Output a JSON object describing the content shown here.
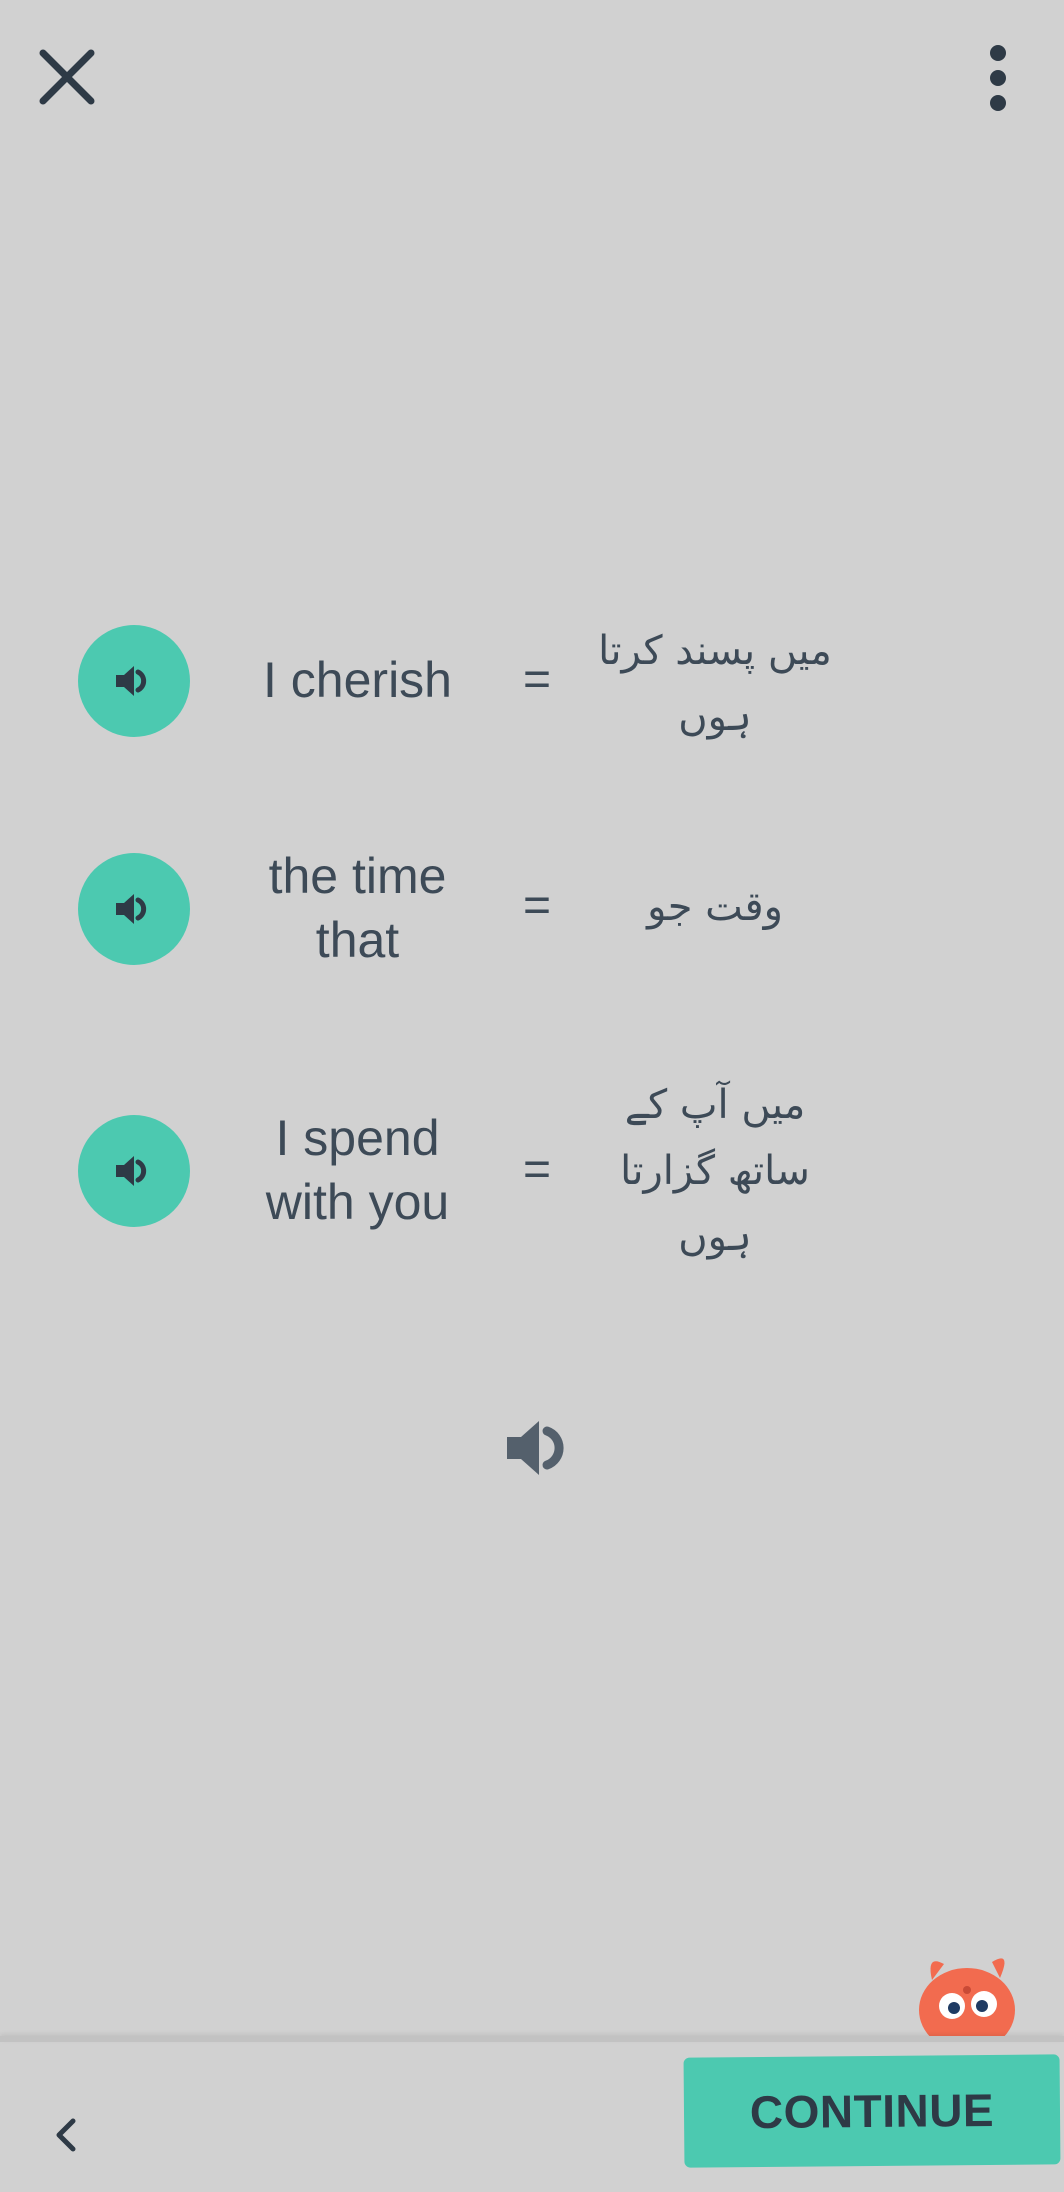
{
  "header": {
    "close_icon": "close-icon",
    "menu_icon": "more-vertical-icon"
  },
  "rows": [
    {
      "english": "I cherish",
      "equals": "=",
      "urdu": "میں پسند کرتا ہوں",
      "icon": "speaker-icon"
    },
    {
      "english": "the time that",
      "equals": "=",
      "urdu": "وقت جو",
      "icon": "speaker-icon"
    },
    {
      "english": "I spend with you",
      "equals": "=",
      "urdu": "میں آپ کے ساتھ گزارتا ہوں",
      "icon": "speaker-icon"
    }
  ],
  "play_all_icon": "speaker-icon",
  "footer": {
    "back_icon": "chevron-left-icon",
    "continue_label": "CONTINUE"
  },
  "colors": {
    "background": "#d1d1d1",
    "accent": "#4cc9b0",
    "text": "#3d4a57",
    "mascot": "#f26b4f"
  }
}
